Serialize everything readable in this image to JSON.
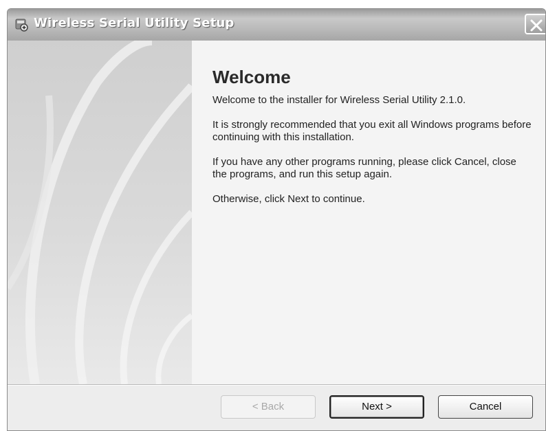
{
  "window": {
    "title": "Wireless Serial Utility Setup",
    "icon": "installer-icon",
    "close_icon": "close-icon"
  },
  "content": {
    "heading": "Welcome",
    "paragraphs": [
      "Welcome to the installer for Wireless Serial Utility 2.1.0.",
      "It is strongly recommended that you exit all Windows programs before continuing with this installation.",
      "If you have any other programs running, please click Cancel, close the programs, and run this setup again.",
      "Otherwise, click Next to continue."
    ]
  },
  "buttons": {
    "back": {
      "label": "< Back",
      "enabled": false
    },
    "next": {
      "label": "Next >",
      "enabled": true
    },
    "cancel": {
      "label": "Cancel",
      "enabled": true
    }
  },
  "colors": {
    "titlebar": "#b6b6b6",
    "panel": "#dadada",
    "content_bg": "#f4f4f4"
  }
}
